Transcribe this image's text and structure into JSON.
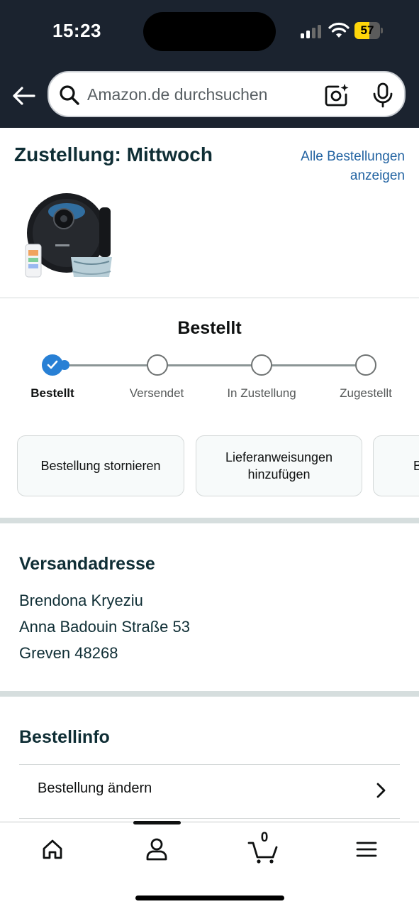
{
  "status_bar": {
    "time": "15:23",
    "battery": "57",
    "battery_level": 0.57,
    "battery_color": "#ffd60a",
    "signal_bars_active": 2
  },
  "header": {
    "back_icon": "arrow-left-icon",
    "search_placeholder": "Amazon.de durchsuchen",
    "search_icon": "magnifier-icon",
    "camera_icon": "camera-scan-icon",
    "mic_icon": "microphone-icon",
    "background": "#1b232f"
  },
  "delivery": {
    "title": "Zustellung: Mittwoch",
    "all_orders_link": "Alle Bestellungen anzeigen",
    "product_image": "robot-vacuum-product-image"
  },
  "tracker": {
    "title": "Bestellt",
    "accent": "#2880d5",
    "steps": [
      {
        "label": "Bestellt",
        "done": true
      },
      {
        "label": "Versendet",
        "done": false
      },
      {
        "label": "In Zustellung",
        "done": false
      },
      {
        "label": "Zugestellt",
        "done": false
      }
    ]
  },
  "actions": [
    {
      "label": "Bestellung stornieren"
    },
    {
      "label": "Lieferanweisungen hinzufügen"
    },
    {
      "label": "B"
    }
  ],
  "address": {
    "title": "Versandadresse",
    "lines": [
      "Brendona Kryeziu",
      "Anna Badouin Straße 53",
      "Greven 48268"
    ]
  },
  "order_info": {
    "title": "Bestellinfo",
    "rows": [
      {
        "label": "Bestellung ändern",
        "icon": "chevron-right-icon"
      }
    ]
  },
  "bottom_nav": {
    "items": [
      {
        "name": "home",
        "icon": "home-icon"
      },
      {
        "name": "account",
        "icon": "user-icon"
      },
      {
        "name": "cart",
        "icon": "cart-icon",
        "count": "0"
      },
      {
        "name": "menu",
        "icon": "hamburger-menu-icon"
      }
    ]
  }
}
